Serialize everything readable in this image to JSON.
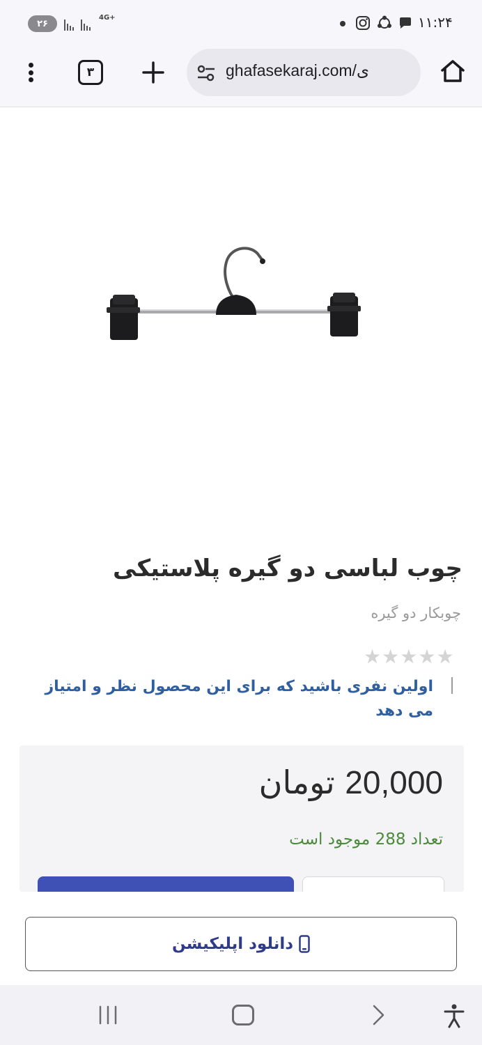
{
  "status_bar": {
    "battery": "۲۶",
    "network": "4G+",
    "time": "۱۱:۲۴"
  },
  "browser": {
    "tab_count": "۳",
    "url": "ghafasekaraj.com/ی",
    "icons": [
      "more-vert-icon",
      "tabs-icon",
      "plus-icon",
      "tune-icon",
      "home-icon"
    ]
  },
  "product": {
    "title": "چوب لباسی دو گیره پلاستیکی",
    "subtitle": "چوبکار دو گیره",
    "rating": {
      "value": 0,
      "max": 5,
      "empty_star_color": "#d4d4d4"
    },
    "review_prompt": "اولین نفری باشید که برای این محصول نظر و امتیاز می دهد",
    "price_amount": "20,000",
    "currency": "تومان",
    "stock_text": "تعداد 288 موجود است",
    "colors": {
      "accent": "#3f51b5",
      "link": "#2f5fa0",
      "stock": "#4a8a3a"
    }
  },
  "download": {
    "label": "دانلود اپلیکیشن",
    "icon": "phone-icon"
  },
  "nav": {
    "icons": [
      "recent-apps-icon",
      "home-nav-icon",
      "back-icon",
      "accessibility-icon"
    ]
  }
}
